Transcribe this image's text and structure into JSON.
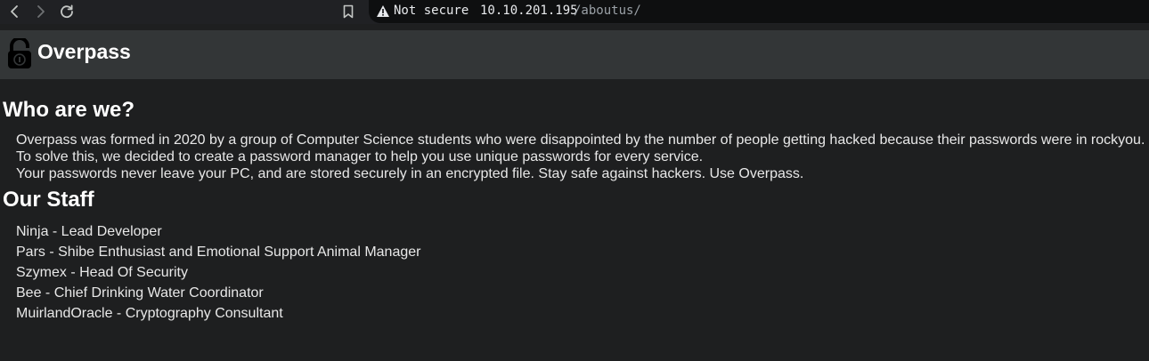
{
  "browser": {
    "security_label": "Not secure",
    "url_host": "10.10.201.195",
    "url_path": "/aboutus/"
  },
  "header": {
    "title": "Overpass"
  },
  "about": {
    "heading": "Who are we?",
    "lines": [
      "Overpass was formed in 2020 by a group of Computer Science students who were disappointed by the number of people getting hacked because their passwords were in rockyou.",
      "To solve this, we decided to create a password manager to help you use unique passwords for every service.",
      "Your passwords never leave your PC, and are stored securely in an encrypted file. Stay safe against hackers. Use Overpass."
    ]
  },
  "staff": {
    "heading": "Our Staff",
    "members": [
      "Ninja - Lead Developer",
      "Pars - Shibe Enthusiast and Emotional Support Animal Manager",
      "Szymex - Head Of Security",
      "Bee - Chief Drinking Water Coordinator",
      "MuirlandOracle - Cryptography Consultant"
    ]
  },
  "colors": {
    "page_background": "#1e1f20",
    "header_background": "#333637",
    "toolbar_background": "#202124",
    "text": "#e8e8e8"
  }
}
